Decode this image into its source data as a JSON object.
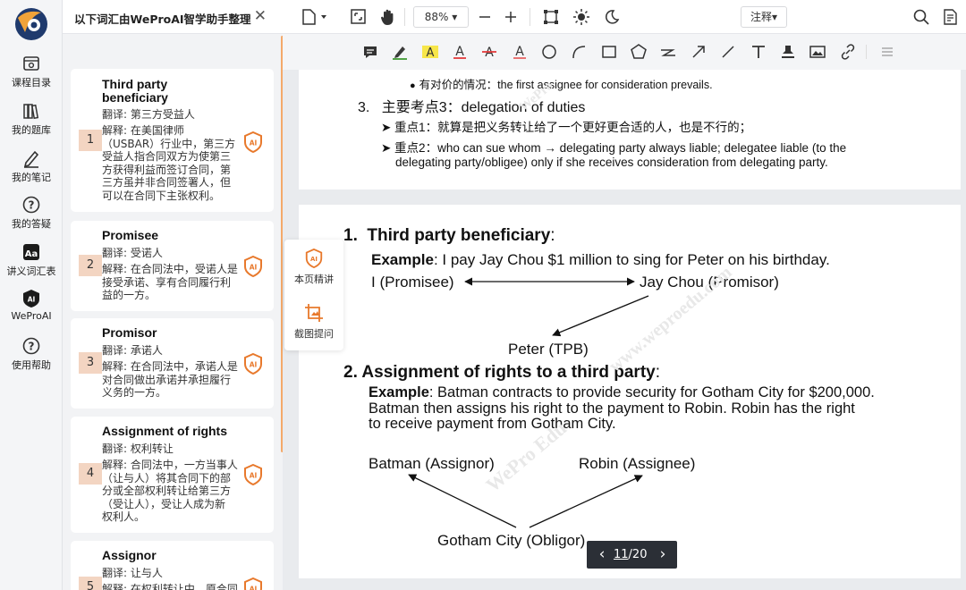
{
  "colors": {
    "accent": "#e8792c",
    "number_badge": "#f3d5c2",
    "text": "#222222"
  },
  "nav": {
    "logo_icon": "weproai-logo-icon",
    "items": [
      {
        "label": "课程目录",
        "icon": "course-catalog-icon"
      },
      {
        "label": "我的题库",
        "icon": "question-bank-icon"
      },
      {
        "label": "我的笔记",
        "icon": "notes-pen-icon"
      },
      {
        "label": "我的答疑",
        "icon": "question-mark-icon"
      },
      {
        "label": "讲义词汇表",
        "icon": "vocabulary-icon"
      },
      {
        "label": "WeProAI",
        "icon": "ai-badge-icon"
      },
      {
        "label": "使用帮助",
        "icon": "help-icon"
      }
    ]
  },
  "vocab": {
    "title": "以下词汇由WeProAI智学助手整理",
    "close": "✕",
    "cards": [
      {
        "num": "1",
        "term": "Third party beneficiary",
        "translation": "翻译: 第三方受益人",
        "explanation": [
          "解释: 在美国律师",
          "（USBAR）行业中，第三方",
          "受益人指合同双方为使第三",
          "方获得利益而签订合同，第",
          "三方虽并非合同签署人，但",
          "可以在合同下主张权利。"
        ]
      },
      {
        "num": "2",
        "term": "Promisee",
        "translation": "翻译: 受诺人",
        "explanation": [
          "解释: 在合同法中，受诺人是",
          "接受承诺、享有合同履行利",
          "益的一方。"
        ]
      },
      {
        "num": "3",
        "term": "Promisor",
        "translation": "翻译: 承诺人",
        "explanation": [
          "解释: 在合同法中，承诺人是",
          "对合同做出承诺并承担履行",
          "义务的一方。"
        ]
      },
      {
        "num": "4",
        "term": "Assignment of rights",
        "translation": "翻译: 权利转让",
        "explanation": [
          "解释: 合同法中，一方当事人",
          "（让与人）将其合同下的部",
          "分或全部权利转让给第三方",
          "（受让人），受让人成为新",
          "权利人。"
        ]
      },
      {
        "num": "5",
        "term": "Assignor",
        "translation": "翻译: 让与人",
        "explanation": [
          "解释: 在权利转让中，原合同"
        ]
      }
    ]
  },
  "toolbar": {
    "zoom": "88%",
    "zoom_caret": "▾",
    "annotate": "注释",
    "annotate_caret": "▾"
  },
  "float_tools": [
    {
      "label": "本页精讲",
      "icon": "ai-lecture-icon"
    },
    {
      "label": "截图提问",
      "icon": "screenshot-crop-icon"
    }
  ],
  "page_nav": {
    "current": "11",
    "total": "/20",
    "prev": "‹",
    "next": "›"
  },
  "doc": {
    "page1": {
      "bullet": "有对价的情况：the first assignee for consideration prevails.",
      "item3_num": "3.",
      "item3_title": "主要考点3：delegation of duties",
      "pt1": "➤ 重点1：就算是把义务转让给了一个更好更合适的人，也是不行的；",
      "pt2_line1": "➤ 重点2：who can sue whom → delegating party always liable; delegatee liable (to the",
      "pt2_line2": "delegating party/obligee) only if she receives consideration from delegating party."
    },
    "page2": {
      "h1_num": "1.",
      "h1_title": "Third party beneficiary",
      "h1_colon": ":",
      "ex1_label": "Example",
      "ex1_text": ": I pay Jay Chou $1 million to sing for Peter on his birthday.",
      "promisee": "I (Promisee)",
      "promisor": "Jay Chou (Promisor)",
      "tpb": "Peter (TPB)",
      "h2_title": "2. Assignment of rights to a third party",
      "h2_colon": ":",
      "ex2_label": "Example",
      "ex2_line1": ": Batman contracts to provide security for Gotham City for $200,000.",
      "ex2_line2": "Batman then assigns his right to the payment to Robin. Robin has the right",
      "ex2_line3": "to receive payment from Gotham City.",
      "assignor": "Batman (Assignor)",
      "assignee": "Robin (Assignee)",
      "obligor": "Gotham City (Obligor)"
    },
    "watermark1": "WePro",
    "watermark2": "WePro Edu",
    "watermark3": "www.weproedu.com"
  }
}
